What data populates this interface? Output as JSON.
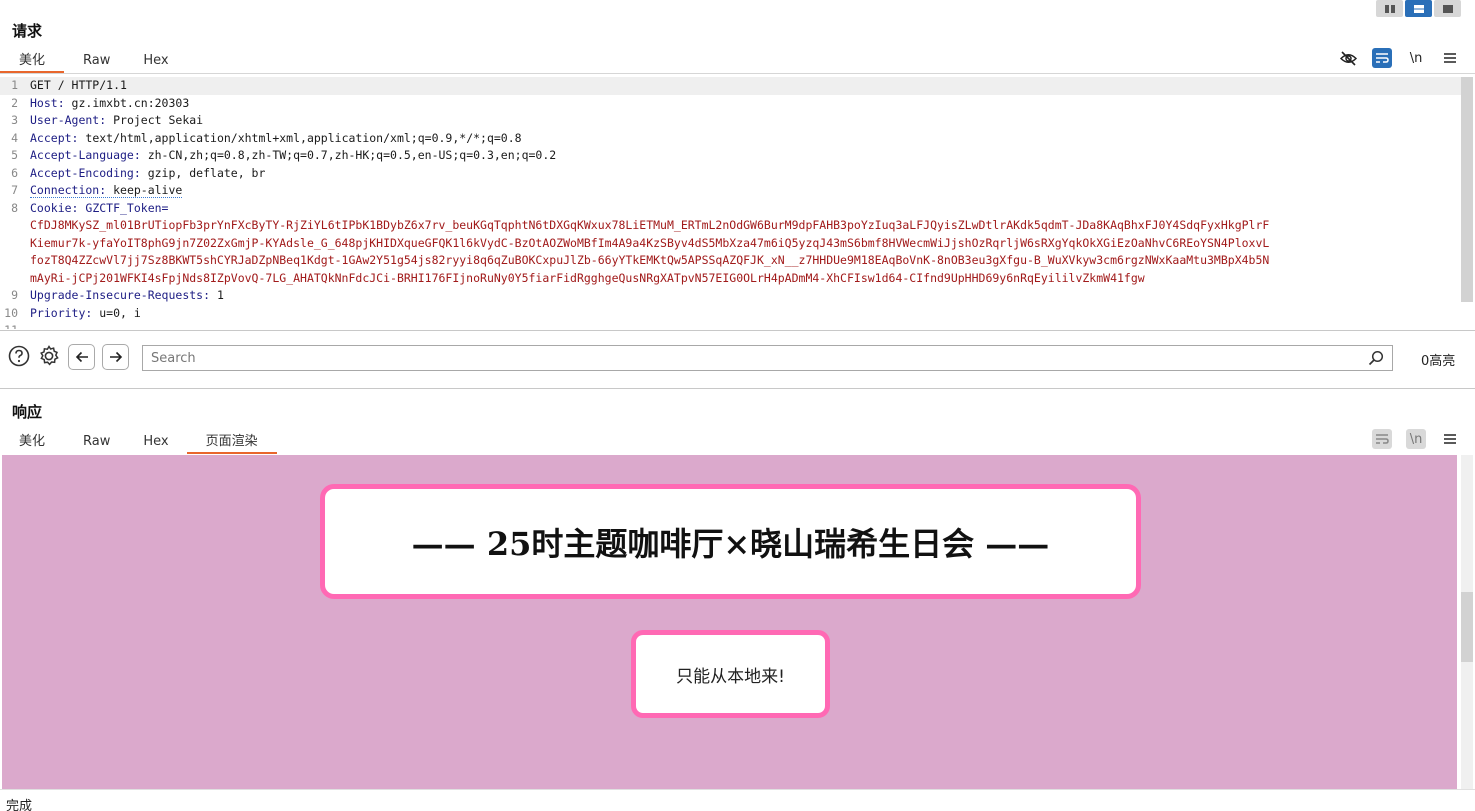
{
  "layout_toggles": [
    "split-vertical-icon",
    "split-horizontal-icon",
    "single-panel-icon"
  ],
  "request": {
    "title": "请求",
    "tabs": [
      "美化",
      "Raw",
      "Hex"
    ],
    "active_tab": "美化",
    "toolbar": {
      "newline_label": "\\n"
    },
    "lines": [
      {
        "n": "1",
        "key": "GET / HTTP/1.1",
        "value": ""
      },
      {
        "n": "2",
        "key": "Host:",
        "value": " gz.imxbt.cn:20303"
      },
      {
        "n": "3",
        "key": "User-Agent:",
        "value": " Project Sekai"
      },
      {
        "n": "4",
        "key": "Accept:",
        "value": " text/html,application/xhtml+xml,application/xml;q=0.9,*/*;q=0.8"
      },
      {
        "n": "5",
        "key": "Accept-Language:",
        "value": " zh-CN,zh;q=0.8,zh-TW;q=0.7,zh-HK;q=0.5,en-US;q=0.3,en;q=0.2"
      },
      {
        "n": "6",
        "key": "Accept-Encoding:",
        "value": " gzip, deflate, br"
      },
      {
        "n": "7",
        "key": "Connection:",
        "value": " keep-alive"
      },
      {
        "n": "8",
        "key": "Cookie:",
        "value": " GZCTF_Token="
      },
      {
        "n": "",
        "key": "",
        "value": "CfDJ8MKySZ_ml01BrUTiopFb3prYnFXcByTY-RjZiYL6tIPbK1BDybZ6x7rv_beuKGqTqphtN6tDXGqKWxux78LiETMuM_ERTmL2nOdGW6BurM9dpFAHB3poYzIuq3aLFJQyisZLwDtlrAKdk5qdmT-JDa8KAqBhxFJ0Y4SdqFyxHkgPlrF"
      },
      {
        "n": "",
        "key": "",
        "value": "Kiemur7k-yfaYoIT8phG9jn7Z02ZxGmjP-KYAdsle_G_648pjKHIDXqueGFQK1l6kVydC-BzOtAOZWoMBfIm4A9a4KzSByv4dS5MbXza47m6iQ5yzqJ43mS6bmf8HVWecmWiJjshOzRqrljW6sRXgYqkOkXGiEzOaNhvC6REoYSN4PloxvL"
      },
      {
        "n": "",
        "key": "",
        "value": "fozT8Q4ZZcwVl7jj7Sz8BKWT5shCYRJaDZpNBeq1Kdgt-1GAw2Y51g54js82ryyi8q6qZuBOKCxpuJlZb-66yYTkEMKtQw5APSSqAZQFJK_xN__z7HHDUe9M18EAqBoVnK-8nOB3eu3gXfgu-B_WuXVkyw3cm6rgzNWxKaaMtu3MBpX4b5N"
      },
      {
        "n": "",
        "key": "",
        "value": "mAyRi-jCPj201WFKI4sFpjNds8IZpVovQ-7LG_AHATQkNnFdcJCi-BRHI176FIjnoRuNy0Y5fiarFidRgghgeQusNRgXATpvN57EIG0OLrH4pADmM4-XhCFIsw1d64-CIfnd9UpHHD69y6nRqEyililvZkmW41fgw"
      },
      {
        "n": "9",
        "key": "Upgrade-Insecure-Requests:",
        "value": " 1"
      },
      {
        "n": "10",
        "key": "Priority:",
        "value": " u=0, i"
      },
      {
        "n": "11",
        "key": "",
        "value": ""
      }
    ]
  },
  "search": {
    "placeholder": "Search",
    "highlights": "0高亮"
  },
  "response": {
    "title": "响应",
    "tabs": [
      "美化",
      "Raw",
      "Hex",
      "页面渲染"
    ],
    "active_tab": "页面渲染",
    "toolbar": {
      "newline_label": "\\n"
    },
    "page": {
      "heading": "—— 25时主题咖啡厅×晓山瑞希生日会 ——",
      "message": "只能从本地来!",
      "background": "#dba9cc",
      "accent": "#ff69b4"
    }
  },
  "status": "完成"
}
